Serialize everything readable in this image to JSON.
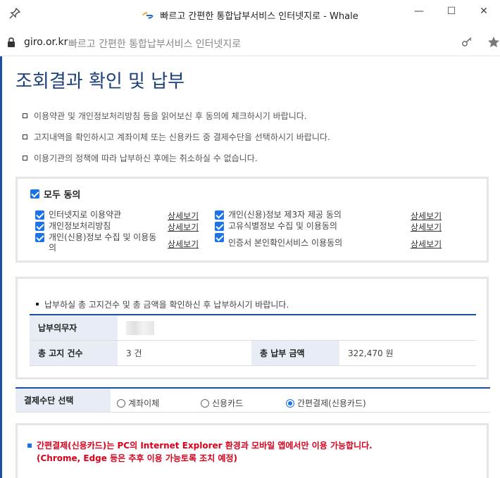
{
  "window": {
    "title": "빠르고 간편한 통합납부서비스 인터넷지로 - Whale",
    "controls": {
      "minimize": "—",
      "maximize": "☐",
      "close": "✕"
    }
  },
  "address_bar": {
    "host": "giro.or.kr",
    "page_title": "빠르고 간편한 통합납부서비스 인터넷지로"
  },
  "page": {
    "title": "조회결과 확인 및 납부",
    "notices": [
      "이용약관 및 개인정보처리방침 등을 읽어보신 후 동의에 체크하시기 바랍니다.",
      "고지내역을 확인하시고 계좌이체 또는 신용카드 중 결제수단을 선택하시기 바랍니다.",
      "이용기관의 정책에 따라 납부하신 후에는 취소하실 수 없습니다."
    ],
    "agreement": {
      "all_label": "모두 동의",
      "detail_label": "상세보기",
      "terms": [
        {
          "label": "인터넷지로 이용약관",
          "checked": true
        },
        {
          "label": "개인정보처리방침",
          "checked": true
        },
        {
          "label": "개인(신용)정보 수집 및 이용동의",
          "checked": true
        },
        {
          "label": "개인(신용)정보 제3자 제공 동의",
          "checked": true
        },
        {
          "label": "고유식별정보 수집 및 이용동의",
          "checked": true
        },
        {
          "label": "인증서 본인확인서비스 이용동의",
          "checked": true
        }
      ]
    },
    "summary": {
      "note": "납부하실 총 고지건수 및 총 금액을 확인하신 후 납부하시기 바랍니다.",
      "payer_label": "납부의무자",
      "count_label": "총 고지 건수",
      "count_value": "3 건",
      "amount_label": "총 납부 금액",
      "amount_value": "322,470 원"
    },
    "payment": {
      "label": "결제수단 선택",
      "options": [
        {
          "label": "계좌이체",
          "selected": false
        },
        {
          "label": "신용카드",
          "selected": false
        },
        {
          "label": "간편결제(신용카드)",
          "selected": true
        }
      ]
    },
    "warning": {
      "line1": "간편결제(신용카드)는 PC의 Internet Explorer 환경과 모바일 앱에서만 이용 가능합니다.",
      "line2": "(Chrome, Edge 등은 추후 이용 가능토록 조치 예정)"
    }
  },
  "colors": {
    "accent": "#1b4fa3",
    "checkbox": "#1a73e8",
    "title": "#1d3f7a",
    "warning": "#d9001b"
  }
}
